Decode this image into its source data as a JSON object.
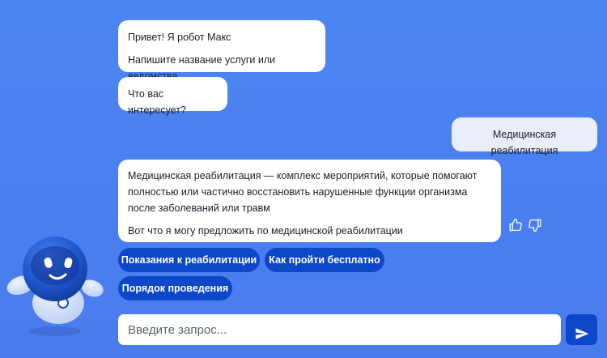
{
  "messages": [
    {
      "sender": "bot",
      "lines": [
        "Привет! Я робот Макс",
        "Напишите название услуги или ведомства"
      ]
    },
    {
      "sender": "bot",
      "lines": [
        "Что вас интересует?"
      ]
    },
    {
      "sender": "user",
      "lines": [
        "Медицинская реабилитация"
      ]
    },
    {
      "sender": "bot",
      "lines": [
        "Медицинская реабилитация — комплекс мероприятий, которые помогают полностью или частично восстановить нарушенные функции организма после заболеваний или травм",
        "Вот что я могу предложить по медицинской реабилитации"
      ]
    }
  ],
  "suggestions": [
    "Показания к реабилитации",
    "Как пройти бесплатно",
    "Порядок проведения"
  ],
  "input": {
    "value": "",
    "placeholder": "Введите запрос..."
  },
  "icons": {
    "like": "thumbs-up-icon",
    "dislike": "thumbs-down-icon",
    "send": "send-icon",
    "avatar": "robot-max-avatar"
  },
  "colors": {
    "background": "#4a7ff0",
    "bot_bubble": "#ffffff",
    "user_bubble": "#e9eef8",
    "accent": "#0d47c9"
  }
}
